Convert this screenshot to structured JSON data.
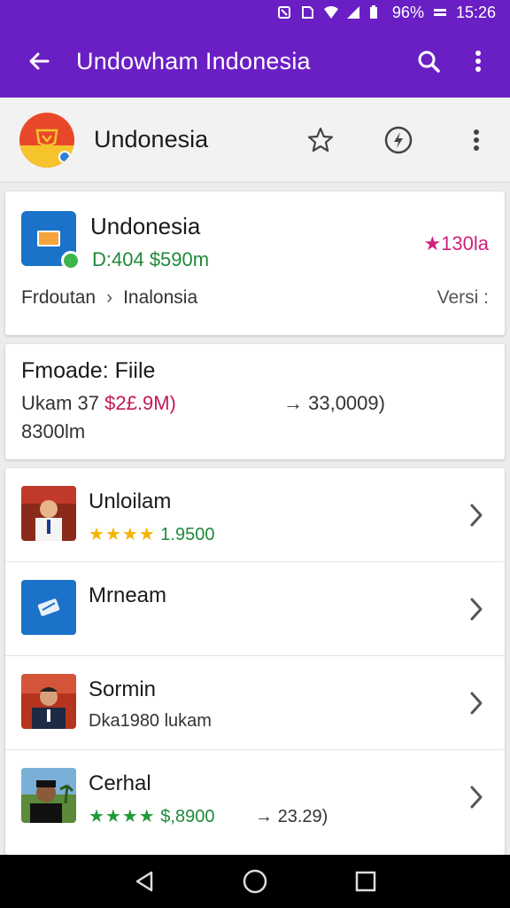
{
  "status_bar": {
    "battery": "96%",
    "time": "15:26"
  },
  "app_bar": {
    "title": "Undowham Indonesia"
  },
  "app_header": {
    "name": "Undonesia"
  },
  "info_card": {
    "title": "Undonesia",
    "subtitle": "D:404 $590m",
    "rating": "★130la",
    "row_left": "Frdoutan",
    "row_sep": "›",
    "row_mid": "Inalonsia",
    "row_right": "Versi :"
  },
  "details_card": {
    "title": "Fmoade: Fiile",
    "line1_prefix": "Ukam 37 ",
    "line1_price": "$2£.9M)",
    "line1_extra": "→ 33,0009)",
    "line2": "8300lm"
  },
  "list": {
    "items": [
      {
        "title": "Unloilam",
        "stars": "★★★★",
        "value": "1.9500",
        "extra": ""
      },
      {
        "title": "Mrneam",
        "stars": "",
        "value": "",
        "extra": ""
      },
      {
        "title": "Sormin",
        "stars": "",
        "value": "Dka1980 lukam",
        "extra": ""
      },
      {
        "title": "Cerhal",
        "stars": "★★★★",
        "value": "$,8900",
        "extra": "→ 23.29)"
      }
    ]
  },
  "colors": {
    "primary": "#6a1fc4",
    "accent_pink": "#d4207c",
    "green": "#1f8a3a",
    "star_gold": "#f4b400"
  }
}
